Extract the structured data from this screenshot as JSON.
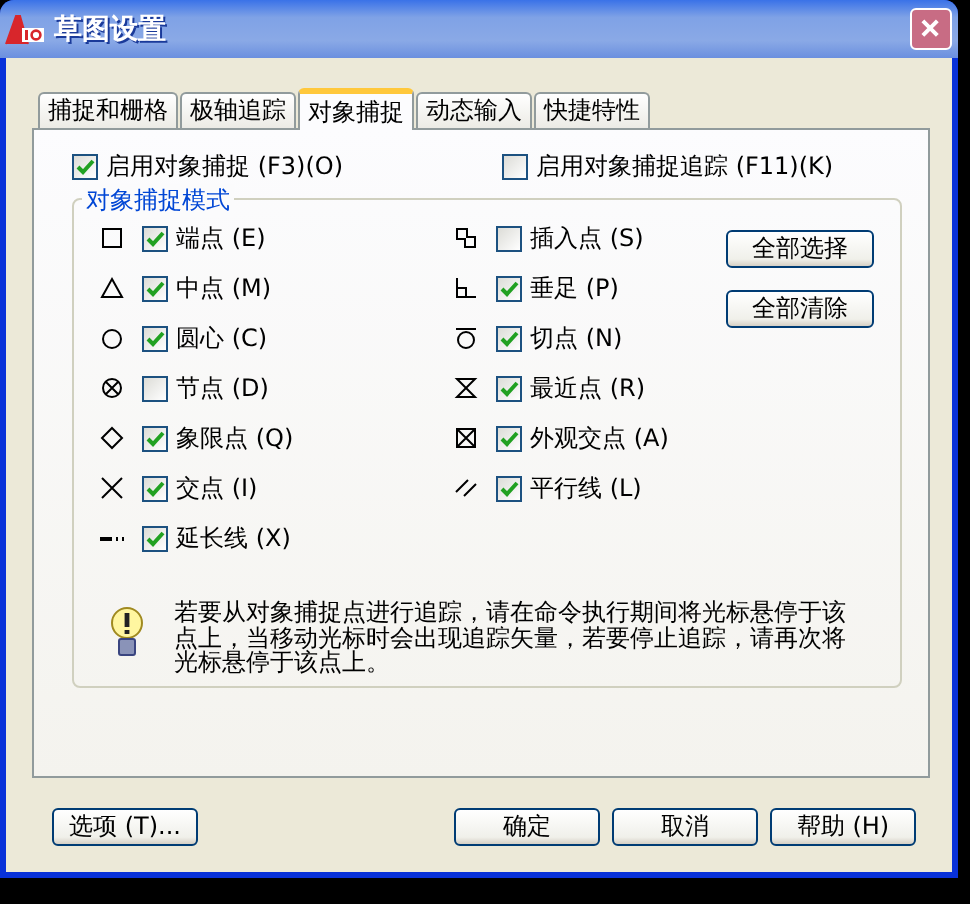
{
  "window": {
    "title": "草图设置"
  },
  "tabs": [
    {
      "label": "捕捉和栅格",
      "selected": false
    },
    {
      "label": "极轴追踪",
      "selected": false
    },
    {
      "label": "对象捕捉",
      "selected": true
    },
    {
      "label": "动态输入",
      "selected": false
    },
    {
      "label": "快捷特性",
      "selected": false
    }
  ],
  "options": [
    {
      "label": "启用对象捕捉 (F3)(O)",
      "checked": true
    },
    {
      "label": "启用对象捕捉追踪 (F11)(K)",
      "checked": false
    }
  ],
  "group": {
    "title": "对象捕捉模式",
    "modes": [
      {
        "kind": "endpoint",
        "label": "端点 (E)",
        "checked": true
      },
      {
        "kind": "midpoint",
        "label": "中点 (M)",
        "checked": true
      },
      {
        "kind": "center",
        "label": "圆心 (C)",
        "checked": true
      },
      {
        "kind": "node",
        "label": "节点 (D)",
        "checked": false
      },
      {
        "kind": "quadrant",
        "label": "象限点 (Q)",
        "checked": true
      },
      {
        "kind": "intersection",
        "label": "交点 (I)",
        "checked": true
      },
      {
        "kind": "extension",
        "label": "延长线 (X)",
        "checked": true
      },
      {
        "kind": "insertion",
        "label": "插入点 (S)",
        "checked": false
      },
      {
        "kind": "perpendicular",
        "label": "垂足 (P)",
        "checked": true
      },
      {
        "kind": "tangent",
        "label": "切点 (N)",
        "checked": true
      },
      {
        "kind": "nearest",
        "label": "最近点 (R)",
        "checked": true
      },
      {
        "kind": "apparent",
        "label": "外观交点 (A)",
        "checked": true
      },
      {
        "kind": "parallel",
        "label": "平行线 (L)",
        "checked": true
      }
    ],
    "buttons": [
      "全部选择",
      "全部清除"
    ]
  },
  "tip": "若要从对象捕捉点进行追踪，请在命令执行期间将光标悬停于该点上，当移动光标时会出现追踪矢量，若要停止追踪，请再次将光标悬停于该点上。",
  "footer": {
    "options_button": "选项 (T)...",
    "buttons": [
      "确定",
      "取消",
      "帮助 (H)"
    ]
  }
}
